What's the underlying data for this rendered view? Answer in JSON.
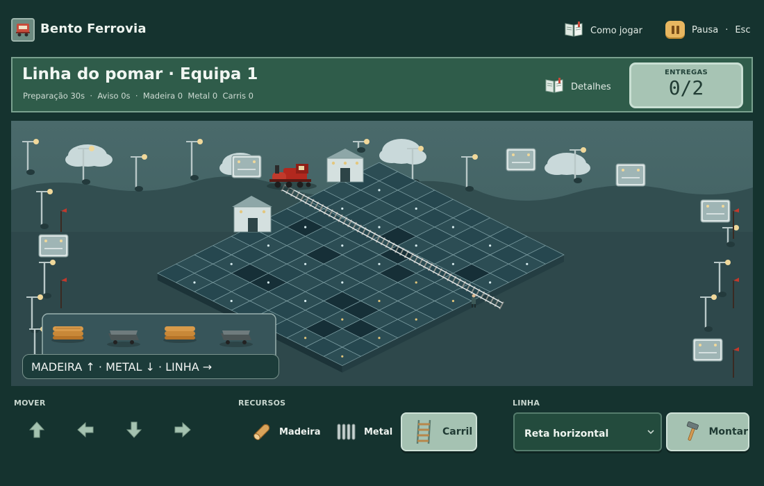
{
  "app": {
    "title": "Bento Ferrovia"
  },
  "header": {
    "how_to_play": "Como jogar",
    "pause_label": "Pausa",
    "pause_sep": "·",
    "pause_key": "Esc"
  },
  "level": {
    "name": "Linha do pomar",
    "sep": "·",
    "team": "Equipa 1",
    "stats": "Preparação 30s  ·  Aviso 0s  ·  Madeira 0  Metal 0  Carris 0",
    "details_label": "Detalhes",
    "deliveries_caption": "ENTREGAS",
    "deliveries_value": "0/2"
  },
  "scene": {
    "hint": "MADEIRA ↑ · METAL ↓ · LINHA →",
    "tray_items": [
      "wood-logs",
      "metal-cart",
      "wood-logs",
      "metal-cart"
    ],
    "colors": {
      "sky": "#3d5b5d",
      "hill": "#324e50",
      "ground": "#2f4a4d",
      "tile_dark": "#1d3a42",
      "tile_light": "#2c4d54",
      "train": "#b2281e"
    }
  },
  "controls": {
    "move_label": "MOVER",
    "resources_label": "RECURSOS",
    "line_label": "LINHA",
    "wood_label": "Madeira",
    "metal_label": "Metal",
    "rail_label": "Carril",
    "line_select_value": "Reta horizontal",
    "build_label": "Montar"
  }
}
